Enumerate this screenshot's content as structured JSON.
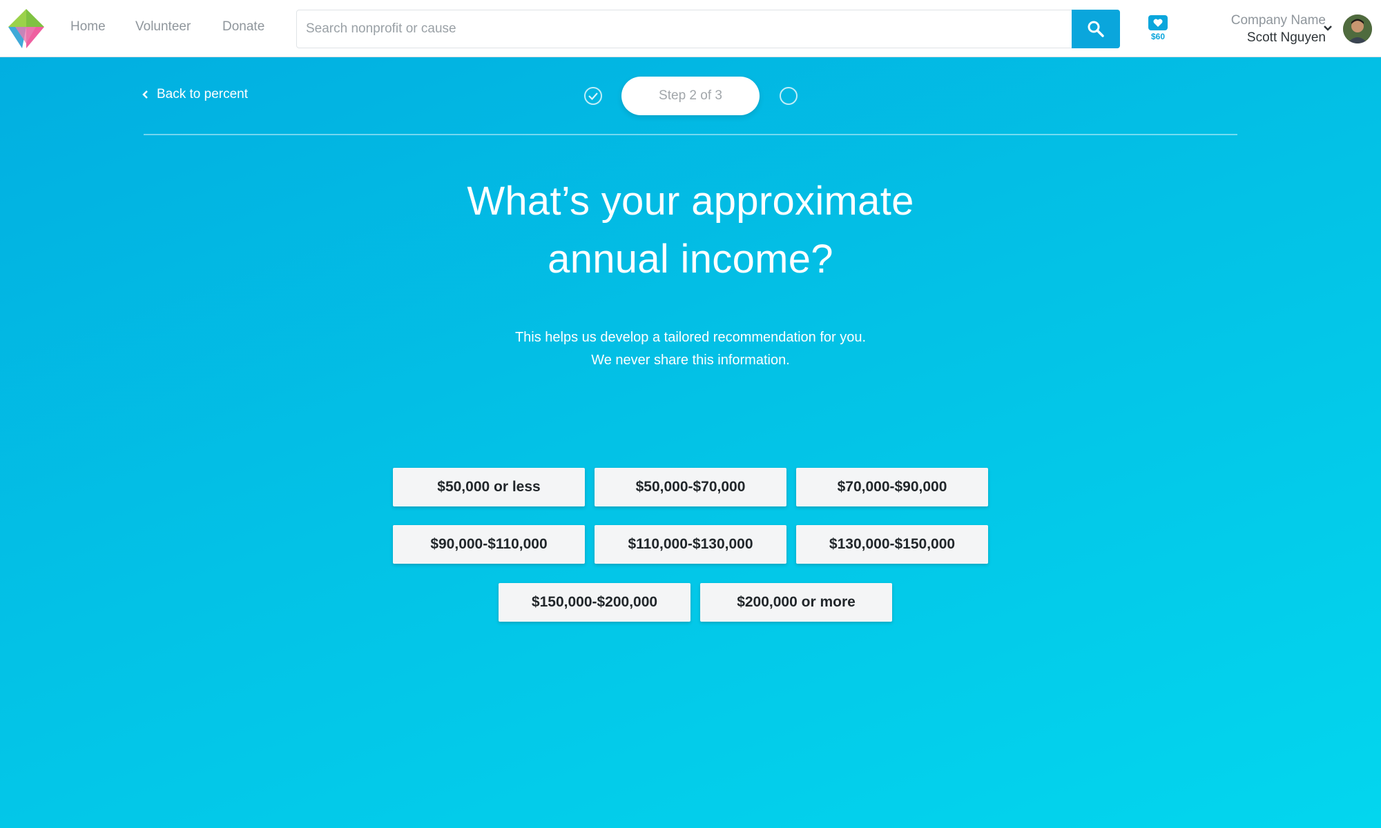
{
  "header": {
    "nav": {
      "home": "Home",
      "volunteer": "Volunteer",
      "donate": "Donate"
    },
    "search": {
      "placeholder": "Search nonprofit or cause",
      "value": ""
    },
    "wallet": {
      "icon": "heart-icon",
      "amount": "$60"
    },
    "account": {
      "company": "Company Name",
      "user": "Scott Nguyen"
    }
  },
  "progress": {
    "back_label": "Back to percent",
    "step_label": "Step 2 of 3",
    "current_step": 2,
    "total_steps": 3
  },
  "question": {
    "line1": "What’s your approximate",
    "line2": "annual income?",
    "help1": "This helps us develop a tailored recommendation for you.",
    "help2": "We never share this information."
  },
  "options": [
    "$50,000 or less",
    "$50,000-$70,000",
    "$70,000-$90,000",
    "$90,000-$110,000",
    "$110,000-$130,000",
    "$130,000-$150,000",
    "$150,000-$200,000",
    "$200,000 or more"
  ],
  "colors": {
    "accent": "#0aa6dc",
    "background_start": "#02ade0",
    "background_end": "#03d6ee"
  }
}
